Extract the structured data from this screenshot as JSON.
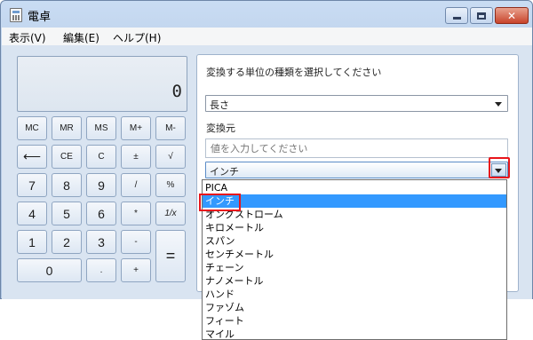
{
  "window": {
    "title": "電卓"
  },
  "menu": [
    "表示(V)",
    "編集(E)",
    "ヘルプ(H)"
  ],
  "display": {
    "value": "0"
  },
  "keys": [
    "MC",
    "MR",
    "MS",
    "M+",
    "M-",
    "⟵",
    "CE",
    "C",
    "±",
    "√",
    "7",
    "8",
    "9",
    "/",
    "%",
    "4",
    "5",
    "6",
    "*",
    "1/x",
    "1",
    "2",
    "3",
    "-",
    "=",
    "0",
    ".",
    "+"
  ],
  "converter": {
    "title": "変換する単位の種類を選択してください",
    "unit_type": "長さ",
    "from_label": "変換元",
    "input_placeholder": "値を入力してください",
    "from_unit": "インチ",
    "options": [
      "PICA",
      "インチ",
      "オングストローム",
      "キロメートル",
      "スパン",
      "センチメートル",
      "チェーン",
      "ナノメートル",
      "ハンド",
      "ファゾム",
      "フィート",
      "マイル"
    ],
    "selected_option": "インチ"
  },
  "colors": {
    "highlight": "#e8151b",
    "selection": "#3399ff",
    "client_background": "#d9e4f1"
  }
}
